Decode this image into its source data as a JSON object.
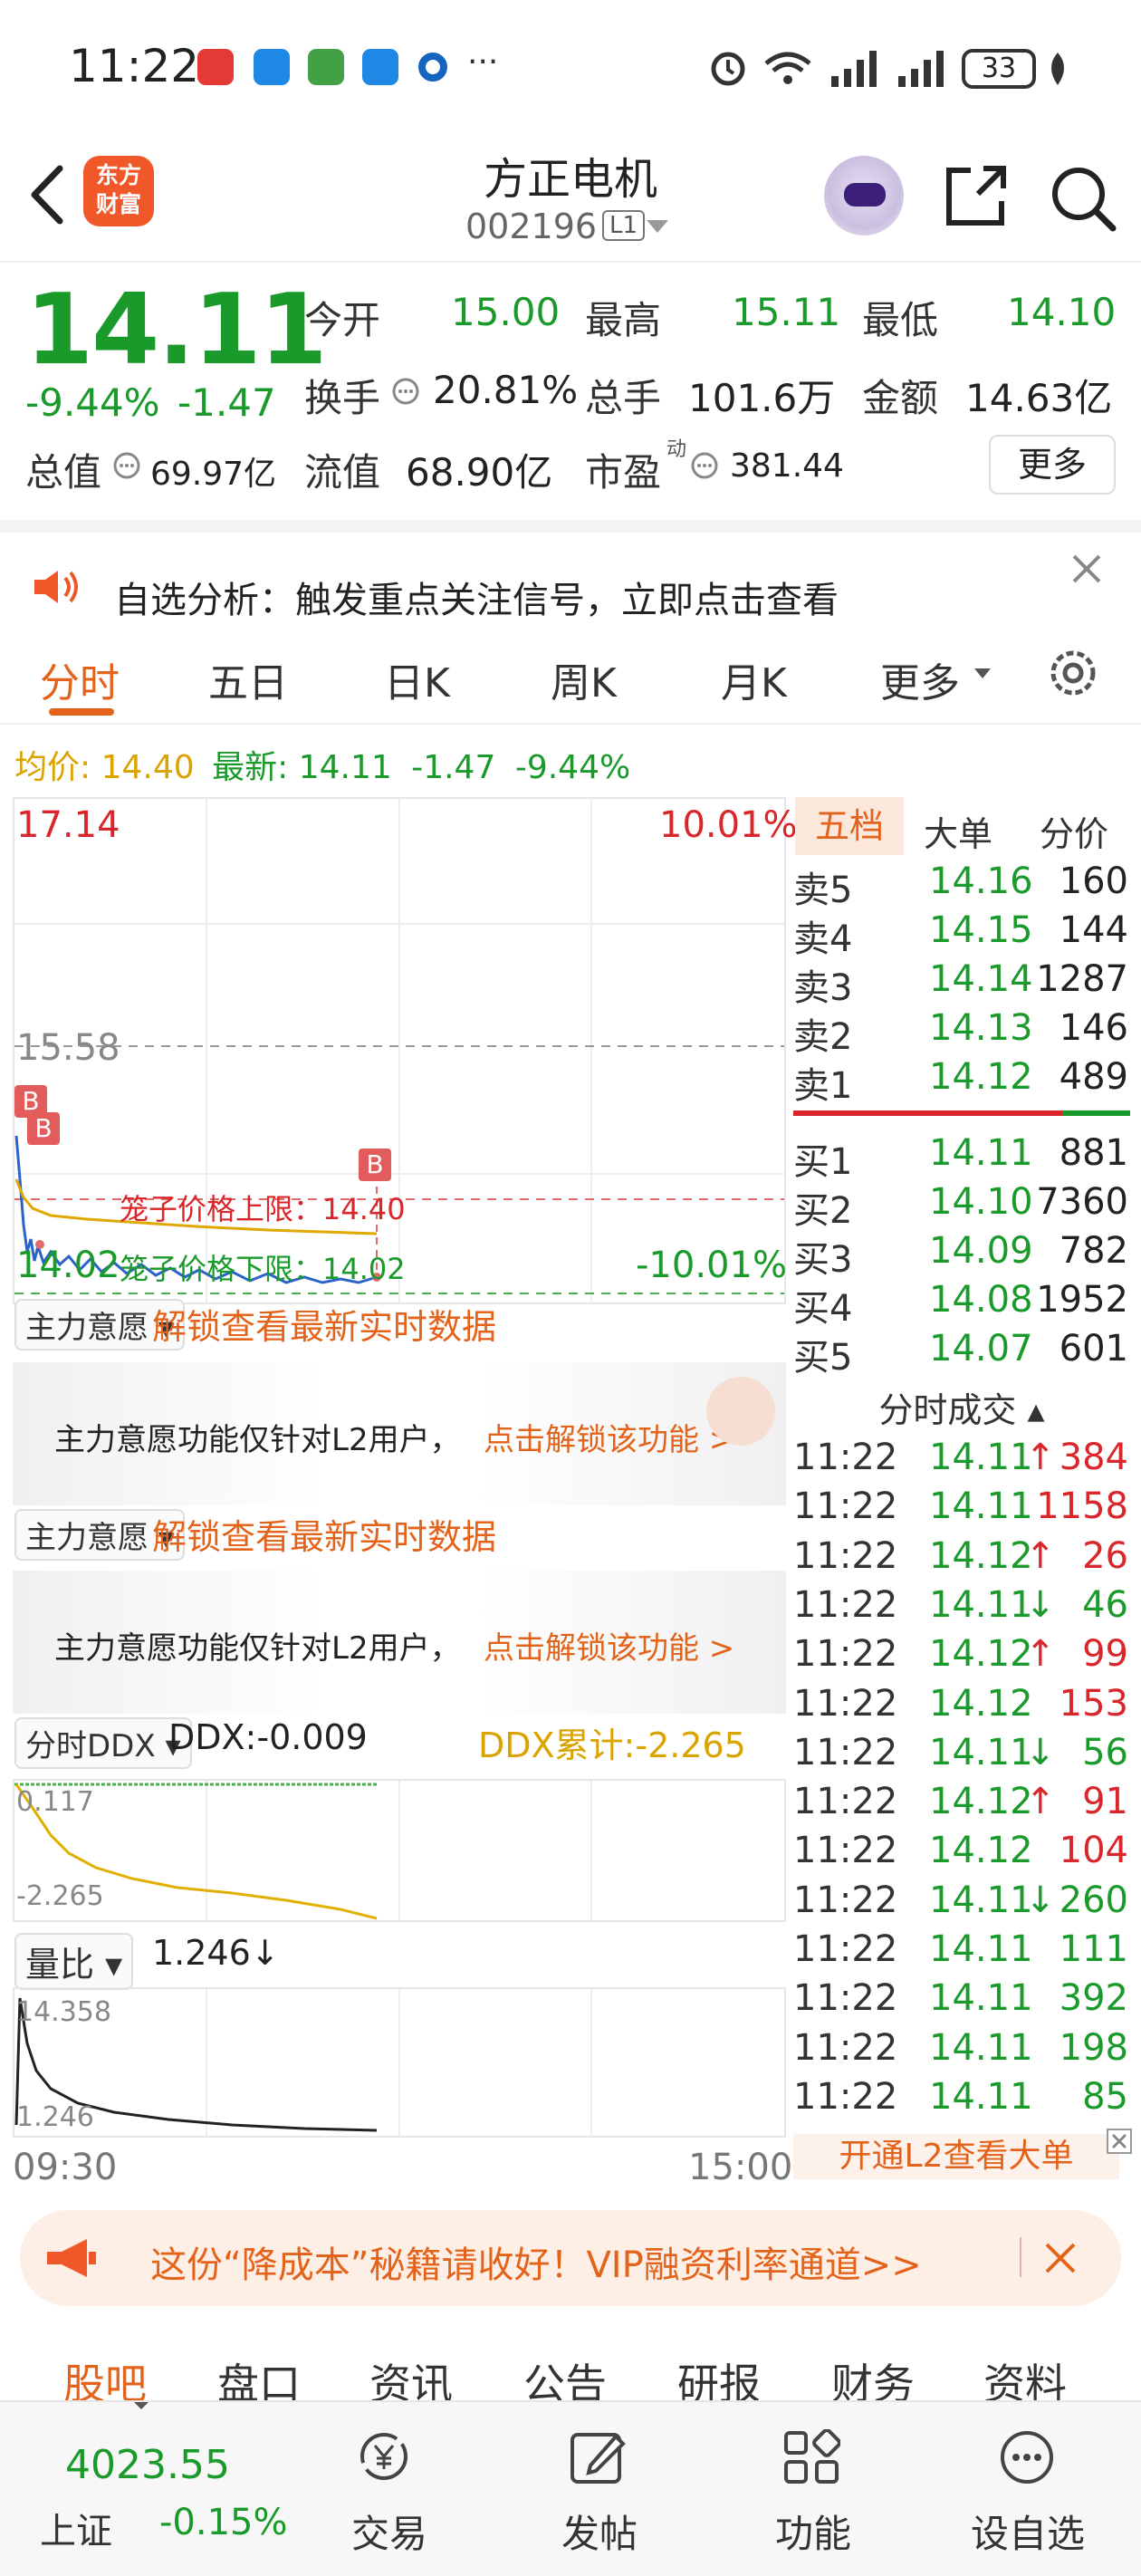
{
  "status_bar": {
    "time": "11:22",
    "battery": "33",
    "more": "···"
  },
  "header": {
    "title": "方正电机",
    "code": "002196",
    "level": "L1",
    "logo_line1": "东方",
    "logo_line2": "财富"
  },
  "quote": {
    "price": "14.11",
    "change_pct": "-9.44%",
    "change": "-1.47",
    "fields": [
      {
        "label": "今开",
        "value": "15.00",
        "color": "#1a9a2a"
      },
      {
        "label": "最高",
        "value": "15.11",
        "color": "#1a9a2a"
      },
      {
        "label": "最低",
        "value": "14.10",
        "color": "#1a9a2a"
      },
      {
        "label": "换手",
        "value": "20.81%",
        "color": "#222222"
      },
      {
        "label": "总手",
        "value": "101.6万",
        "color": "#222222"
      },
      {
        "label": "金额",
        "value": "14.63亿",
        "color": "#222222"
      }
    ],
    "total_value_label": "总值",
    "total_value": "69.97亿",
    "float_value_label": "流值",
    "float_value": "68.90亿",
    "pe_label": "市盈",
    "pe_sup": "动",
    "pe_value": "381.44",
    "more_label": "更多"
  },
  "notice": {
    "text": "自选分析：触发重点关注信号，立即点击查看"
  },
  "tabs": [
    "分时",
    "五日",
    "日K",
    "周K",
    "月K",
    "更多"
  ],
  "active_tab": "分时",
  "avg_line": {
    "avg_label": "均价:",
    "avg_value": "14.40",
    "latest_label": "最新:",
    "latest_value": "14.11",
    "change": "-1.47",
    "pct": "-9.44%"
  },
  "chart": {
    "y_top": "17.14",
    "y_mid": "15.58",
    "y_bottom": "14.02",
    "pct_top": "10.01%",
    "pct_bottom": "-10.01%",
    "cage_upper": "笼子价格上限：14.40",
    "cage_lower": "笼子价格下限：14.02",
    "b_marker": "B",
    "time_start": "09:30",
    "time_end": "15:00"
  },
  "panels": {
    "main_will_1": "主力意愿",
    "unlock_1": "解锁查看最新实时数据",
    "lock_text_1": "主力意愿功能仅针对L2用户，",
    "lock_link_1": "点击解锁该功能 >",
    "main_will_2": "主力意愿",
    "unlock_2": "解锁查看最新实时数据",
    "lock_text_2": "主力意愿功能仅针对L2用户，",
    "lock_link_2": "点击解锁该功能 >",
    "ddx_select": "分时DDX",
    "ddx_value": "DDX:-0.009",
    "ddx_total": "DDX累计:-2.265",
    "ddx_top": "0.117",
    "ddx_bottom": "-2.265",
    "vr_select": "量比",
    "vr_value": "1.246",
    "vr_arrow": "↓",
    "vr_top": "14.358",
    "vr_bottom": "1.246"
  },
  "orderbook": {
    "tabs": [
      "五档",
      "大单",
      "分价"
    ],
    "active": "五档",
    "sells": [
      {
        "label": "卖5",
        "price": "14.16",
        "vol": "160"
      },
      {
        "label": "卖4",
        "price": "14.15",
        "vol": "144"
      },
      {
        "label": "卖3",
        "price": "14.14",
        "vol": "1287"
      },
      {
        "label": "卖2",
        "price": "14.13",
        "vol": "146"
      },
      {
        "label": "卖1",
        "price": "14.12",
        "vol": "489"
      }
    ],
    "buys": [
      {
        "label": "买1",
        "price": "14.11",
        "vol": "881"
      },
      {
        "label": "买2",
        "price": "14.10",
        "vol": "7360"
      },
      {
        "label": "买3",
        "price": "14.09",
        "vol": "782"
      },
      {
        "label": "买4",
        "price": "14.08",
        "vol": "1952"
      },
      {
        "label": "买5",
        "price": "14.07",
        "vol": "601"
      }
    ],
    "ticks_title": "分时成交",
    "ticks": [
      {
        "time": "11:22",
        "price": "14.11",
        "dir": "↑",
        "vol": "384",
        "volcolor": "#d9262b"
      },
      {
        "time": "11:22",
        "price": "14.11",
        "dir": "",
        "vol": "1158",
        "volcolor": "#d9262b"
      },
      {
        "time": "11:22",
        "price": "14.12",
        "dir": "↑",
        "vol": "26",
        "volcolor": "#d9262b"
      },
      {
        "time": "11:22",
        "price": "14.11",
        "dir": "↓",
        "vol": "46",
        "volcolor": "#1a9a2a"
      },
      {
        "time": "11:22",
        "price": "14.12",
        "dir": "↑",
        "vol": "99",
        "volcolor": "#d9262b"
      },
      {
        "time": "11:22",
        "price": "14.12",
        "dir": "",
        "vol": "153",
        "volcolor": "#d9262b"
      },
      {
        "time": "11:22",
        "price": "14.11",
        "dir": "↓",
        "vol": "56",
        "volcolor": "#1a9a2a"
      },
      {
        "time": "11:22",
        "price": "14.12",
        "dir": "↑",
        "vol": "91",
        "volcolor": "#d9262b"
      },
      {
        "time": "11:22",
        "price": "14.12",
        "dir": "",
        "vol": "104",
        "volcolor": "#d9262b"
      },
      {
        "time": "11:22",
        "price": "14.11",
        "dir": "↓",
        "vol": "260",
        "volcolor": "#1a9a2a"
      },
      {
        "time": "11:22",
        "price": "14.11",
        "dir": "",
        "vol": "111",
        "volcolor": "#1a9a2a"
      },
      {
        "time": "11:22",
        "price": "14.11",
        "dir": "",
        "vol": "392",
        "volcolor": "#1a9a2a"
      },
      {
        "time": "11:22",
        "price": "14.11",
        "dir": "",
        "vol": "198",
        "volcolor": "#1a9a2a"
      },
      {
        "time": "11:22",
        "price": "14.11",
        "dir": "",
        "vol": "85",
        "volcolor": "#1a9a2a"
      }
    ],
    "l2_link": "开通L2查看大单"
  },
  "ad": {
    "text": "这份“降成本”秘籍请收好！VIP融资利率通道>>"
  },
  "bottom_tabs": [
    "股吧",
    "盘口",
    "资讯",
    "公告",
    "研报",
    "财务",
    "资料"
  ],
  "bottom_active": "股吧",
  "nav": {
    "index_value": "4023.55",
    "index_name": "上证",
    "index_change": "-0.15%",
    "items": [
      {
        "label": "交易",
        "icon": "yen-cycle-icon"
      },
      {
        "label": "发帖",
        "icon": "edit-icon"
      },
      {
        "label": "功能",
        "icon": "grid-icon"
      },
      {
        "label": "设自选",
        "icon": "dots-icon"
      }
    ]
  },
  "colors": {
    "up": "#d9262b",
    "down": "#1a9a2a",
    "accent": "#e4631b",
    "avg": "#d9a300"
  }
}
